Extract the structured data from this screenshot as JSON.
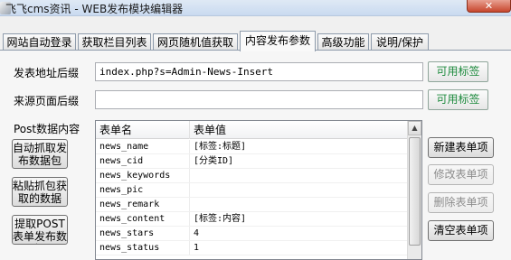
{
  "window": {
    "title": "飞飞cms资讯 - WEB发布模块编辑器",
    "close_glyph": "✕"
  },
  "tabs": [
    {
      "label": "网站自动登录"
    },
    {
      "label": "获取栏目列表"
    },
    {
      "label": "网页随机值获取"
    },
    {
      "label": "内容发布参数",
      "active": true
    },
    {
      "label": "高级功能"
    },
    {
      "label": "说明/保护"
    }
  ],
  "form": {
    "post_url_suffix_label": "发表地址后缀",
    "post_url_suffix_value": "index.php?s=Admin-News-Insert",
    "referer_suffix_label": "来源页面后缀",
    "referer_suffix_value": "",
    "available_tags_label": "可用标签",
    "post_data_label": "Post数据内容"
  },
  "left_buttons": {
    "auto_capture": "自动抓取发布数据包",
    "paste_capture": "粘贴抓包获取的数据",
    "extract_post": "提取POST表单发布数据"
  },
  "table": {
    "columns": [
      "表单名",
      "表单值"
    ],
    "rows": [
      {
        "name": "news_name",
        "value": "[标签:标题]"
      },
      {
        "name": "news_cid",
        "value": "[分类ID]"
      },
      {
        "name": "news_keywords",
        "value": ""
      },
      {
        "name": "news_pic",
        "value": ""
      },
      {
        "name": "news_remark",
        "value": ""
      },
      {
        "name": "news_content",
        "value": "[标签:内容]"
      },
      {
        "name": "news_stars",
        "value": "4"
      },
      {
        "name": "news_status",
        "value": "1"
      }
    ]
  },
  "right_buttons": {
    "new_item": "新建表单项",
    "edit_item": "修改表单项",
    "delete_item": "删除表单项",
    "clear_items": "清空表单项"
  },
  "colors": {
    "accent_green": "#1d8a3d",
    "close_red": "#c7452c"
  }
}
